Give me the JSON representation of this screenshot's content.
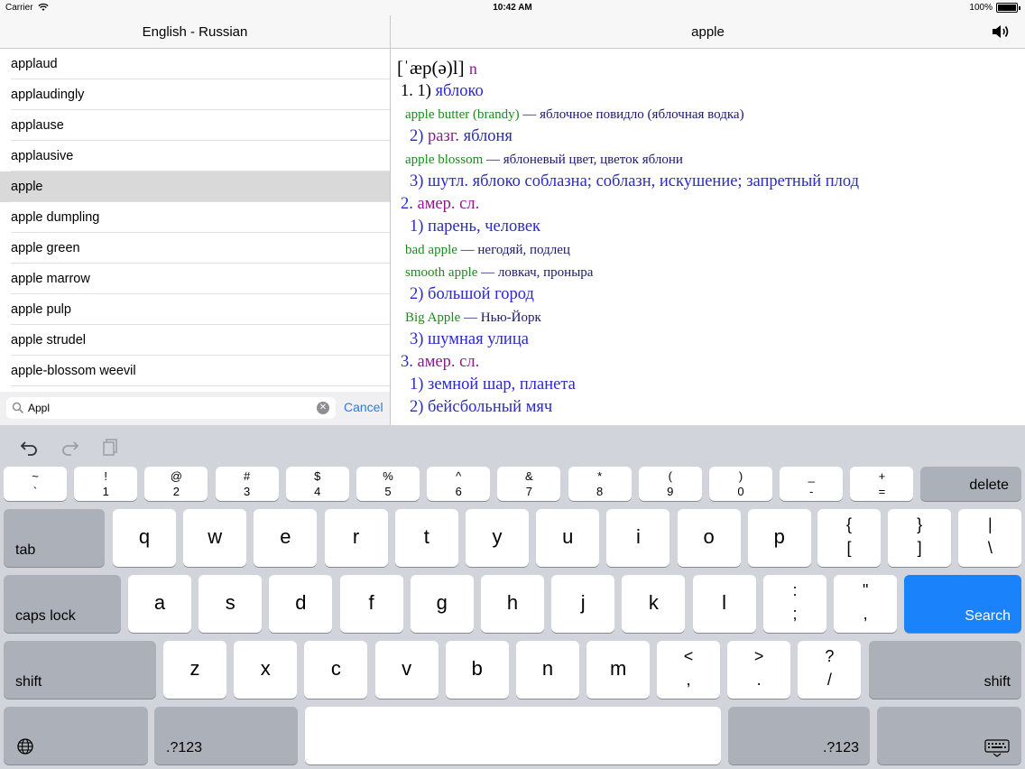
{
  "status_bar": {
    "carrier": "Carrier",
    "time": "10:42 AM",
    "battery": "100%"
  },
  "left_panel": {
    "title": "English - Russian",
    "words": [
      "applaud",
      "applaudingly",
      "applause",
      "applausive",
      "apple",
      "apple dumpling",
      "apple green",
      "apple marrow",
      "apple pulp",
      "apple strudel",
      "apple-blossom weevil"
    ],
    "selected_index": 4,
    "search": {
      "value": "Appl",
      "cancel_label": "Cancel"
    }
  },
  "right_panel": {
    "title": "apple",
    "entry": {
      "transcription": "[ˈæp(ə)l]",
      "pos": "n",
      "l1": "1. 1)",
      "l1_word": "яблоко",
      "ex1_en": "apple butter (brandy)",
      "ex1_ru": "— яблочное повидло (яблочная водка)",
      "l2_num": "2)",
      "l2_note": "разг.",
      "l2_word": "яблоня",
      "ex2_en": "apple blossom",
      "ex2_ru": "— яблоневый цвет, цветок яблони",
      "l3_num": "3)",
      "l3_note": "шутл.",
      "l3_word": "яблоко соблазна; соблазн, искушение; запретный плод",
      "s2_num": "2.",
      "s2_note": "амер. сл.",
      "s2_1_num": "1)",
      "s2_1_word": "парень, человек",
      "ex3_en": "bad apple",
      "ex3_ru": "— негодяй, подлец",
      "ex4_en": "smooth apple",
      "ex4_ru": "— ловкач, проныра",
      "s2_2_num": "2)",
      "s2_2_word": "большой город",
      "ex5_en": "Big Apple",
      "ex5_ru": "— Нью-Йорк",
      "s2_3_num": "3)",
      "s2_3_word": "шумная улица",
      "s3_num": "3.",
      "s3_note": "амер. сл.",
      "s3_1_num": "1)",
      "s3_1_word": "земной шар, планета",
      "s3_2_num": "2)",
      "s3_2_word": "бейсбольный мяч"
    }
  },
  "keyboard": {
    "number_row": [
      {
        "top": "~",
        "bottom": "`"
      },
      {
        "top": "!",
        "bottom": "1"
      },
      {
        "top": "@",
        "bottom": "2"
      },
      {
        "top": "#",
        "bottom": "3"
      },
      {
        "top": "$",
        "bottom": "4"
      },
      {
        "top": "%",
        "bottom": "5"
      },
      {
        "top": "^",
        "bottom": "6"
      },
      {
        "top": "&",
        "bottom": "7"
      },
      {
        "top": "*",
        "bottom": "8"
      },
      {
        "top": "(",
        "bottom": "9"
      },
      {
        "top": ")",
        "bottom": "0"
      },
      {
        "top": "_",
        "bottom": "-"
      },
      {
        "top": "+",
        "bottom": "="
      }
    ],
    "delete_label": "delete",
    "tab_label": "tab",
    "row_q": [
      "q",
      "w",
      "e",
      "r",
      "t",
      "y",
      "u",
      "i",
      "o",
      "p"
    ],
    "row_q_extra": [
      {
        "top": "{",
        "bottom": "["
      },
      {
        "top": "}",
        "bottom": "]"
      },
      {
        "top": "|",
        "bottom": "\\"
      }
    ],
    "caps_label": "caps lock",
    "row_a": [
      "a",
      "s",
      "d",
      "f",
      "g",
      "h",
      "j",
      "k",
      "l"
    ],
    "row_a_extra": [
      {
        "top": ":",
        "bottom": ";"
      },
      {
        "top": "\"",
        "bottom": ","
      }
    ],
    "search_label": "Search",
    "shift_label": "shift",
    "row_z": [
      "z",
      "x",
      "c",
      "v",
      "b",
      "n",
      "m"
    ],
    "row_z_extra": [
      {
        "top": "<",
        "bottom": ","
      },
      {
        "top": ">",
        "bottom": "."
      },
      {
        "top": "?",
        "bottom": "/"
      }
    ],
    "numbers_label": ".?123",
    "accent_color": "#1a82fb"
  }
}
